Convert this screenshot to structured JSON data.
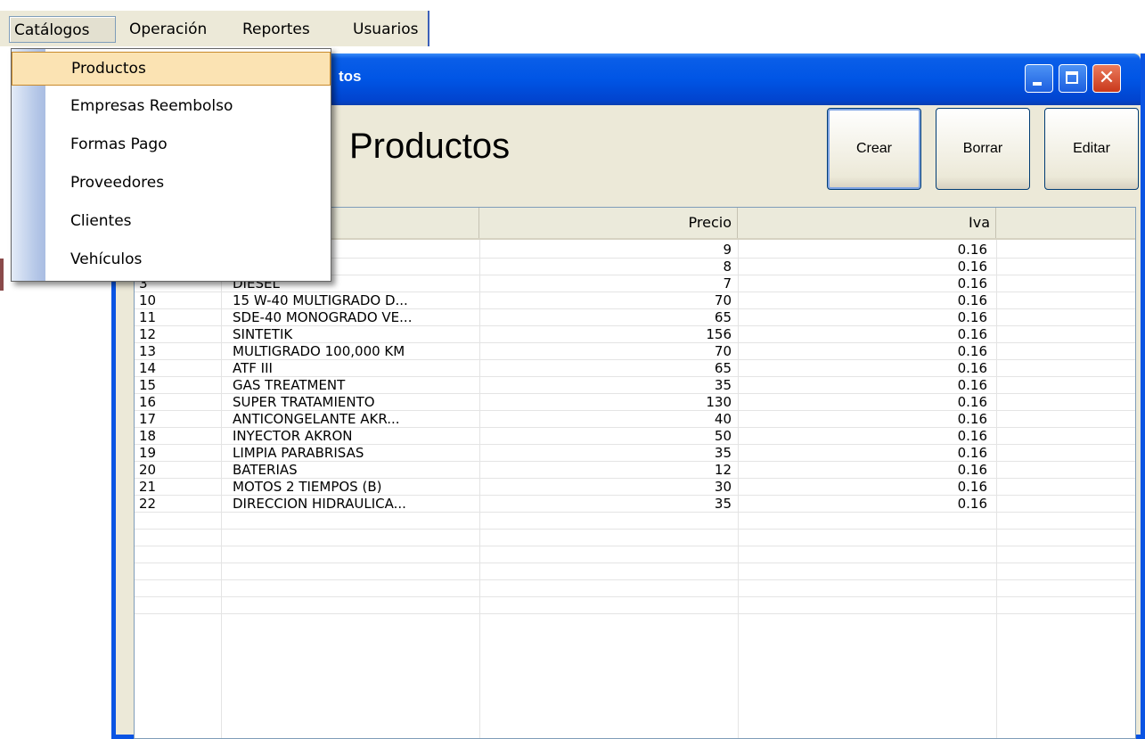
{
  "menubar": {
    "items": [
      "Catálogos",
      "Operación",
      "Reportes",
      "Usuarios"
    ]
  },
  "dropdown": {
    "items": [
      "Productos",
      "Empresas Reembolso",
      "Formas Pago",
      "Proveedores",
      "Clientes",
      "Vehículos"
    ],
    "highlighted": "Productos"
  },
  "window": {
    "title_visible_fragment": "tos",
    "page_title": "Productos",
    "buttons": {
      "crear": "Crear",
      "borrar": "Borrar",
      "editar": "Editar"
    }
  },
  "grid": {
    "columns": [
      "Precio",
      "Iva"
    ],
    "rows": [
      {
        "id": "",
        "name": "",
        "precio": "9",
        "iva": "0.16"
      },
      {
        "id": "",
        "name": "",
        "precio": "8",
        "iva": "0.16"
      },
      {
        "id": "3",
        "name": "DIESEL",
        "precio": "7",
        "iva": "0.16"
      },
      {
        "id": "10",
        "name": "15 W-40 MULTIGRADO D...",
        "precio": "70",
        "iva": "0.16"
      },
      {
        "id": "11",
        "name": "SDE-40 MONOGRADO VE...",
        "precio": "65",
        "iva": "0.16"
      },
      {
        "id": "12",
        "name": "SINTETIK",
        "precio": "156",
        "iva": "0.16"
      },
      {
        "id": "13",
        "name": "MULTIGRADO 100,000 KM",
        "precio": "70",
        "iva": "0.16"
      },
      {
        "id": "14",
        "name": "ATF III",
        "precio": "65",
        "iva": "0.16"
      },
      {
        "id": "15",
        "name": "GAS TREATMENT",
        "precio": "35",
        "iva": "0.16"
      },
      {
        "id": "16",
        "name": "SUPER TRATAMIENTO",
        "precio": "130",
        "iva": "0.16"
      },
      {
        "id": "17",
        "name": "ANTICONGELANTE AKR...",
        "precio": "40",
        "iva": "0.16"
      },
      {
        "id": "18",
        "name": "INYECTOR AKRON",
        "precio": "50",
        "iva": "0.16"
      },
      {
        "id": "19",
        "name": "LIMPIA PARABRISAS",
        "precio": "35",
        "iva": "0.16"
      },
      {
        "id": "20",
        "name": "BATERIAS",
        "precio": "12",
        "iva": "0.16"
      },
      {
        "id": "21",
        "name": "MOTOS 2 TIEMPOS  (B)",
        "precio": "30",
        "iva": "0.16"
      },
      {
        "id": "22",
        "name": "DIRECCION HIDRAULICA...",
        "precio": "35",
        "iva": "0.16"
      }
    ],
    "empty_rows": 6
  },
  "colors": {
    "titlebar": "#0055e5",
    "window_border": "#0a54e3",
    "menu_highlight": "#fbe3b3",
    "face": "#ece9d8"
  }
}
